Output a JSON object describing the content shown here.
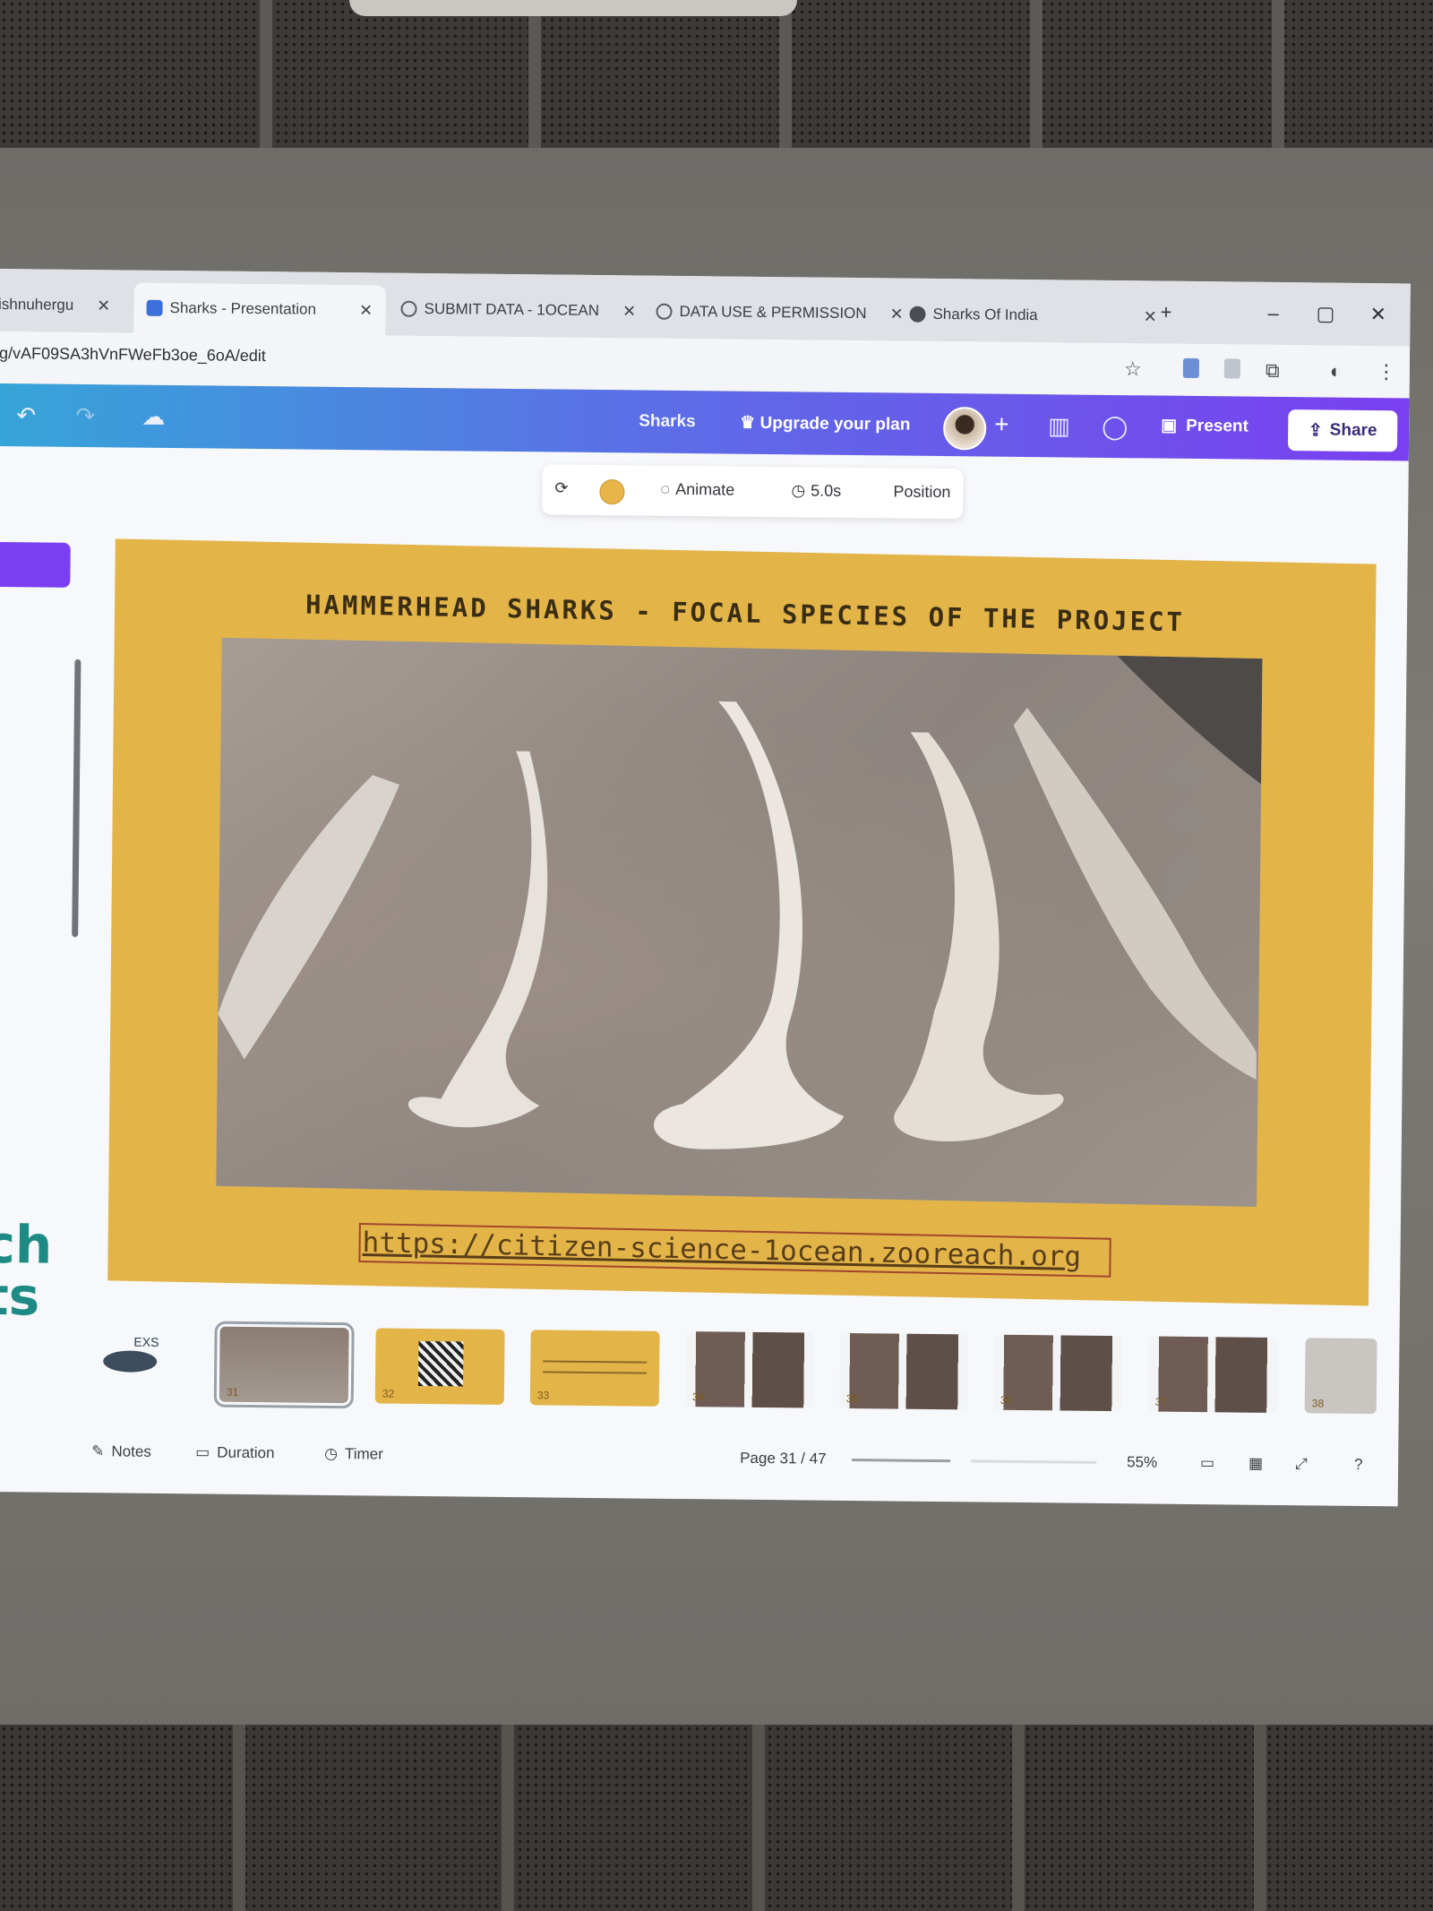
{
  "browser": {
    "tabs": [
      {
        "label": "vishnuhergu",
        "active": false
      },
      {
        "label": "Sharks - Presentation",
        "active": true
      },
      {
        "label": "SUBMIT DATA - 1OCEAN",
        "active": false
      },
      {
        "label": "DATA USE & PERMISSION",
        "active": false
      },
      {
        "label": "Sharks Of India",
        "active": false
      }
    ],
    "new_tab": "+",
    "url": "g/vAF09SA3hVnFWeFb3oe_6oA/edit"
  },
  "canva": {
    "doc_title": "Sharks",
    "upgrade_label": "Upgrade your plan",
    "present_label": "Present",
    "share_label": "Share"
  },
  "toolbar": {
    "animate_label": "Animate",
    "duration_label": "5.0s",
    "position_label": "Position",
    "color_hex": "#e8b54a"
  },
  "slide": {
    "title": "HAMMERHEAD SHARKS - FOCAL SPECIES OF THE PROJECT",
    "link": "https://citizen-science-1ocean.zooreach.org",
    "background_color": "#e3b549"
  },
  "sidebar": {
    "partial_text": "ch\nts"
  },
  "thumbnails": [
    {
      "num": "",
      "label": "EXS"
    },
    {
      "num": "31",
      "selected": true
    },
    {
      "num": "32"
    },
    {
      "num": "33"
    },
    {
      "num": "34"
    },
    {
      "num": "35"
    },
    {
      "num": "36"
    },
    {
      "num": "37"
    },
    {
      "num": "38"
    }
  ],
  "bottombar": {
    "notes_label": "Notes",
    "duration_label": "Duration",
    "timer_label": "Timer",
    "page_label": "Page 31 / 47",
    "zoom_label": "55%"
  }
}
